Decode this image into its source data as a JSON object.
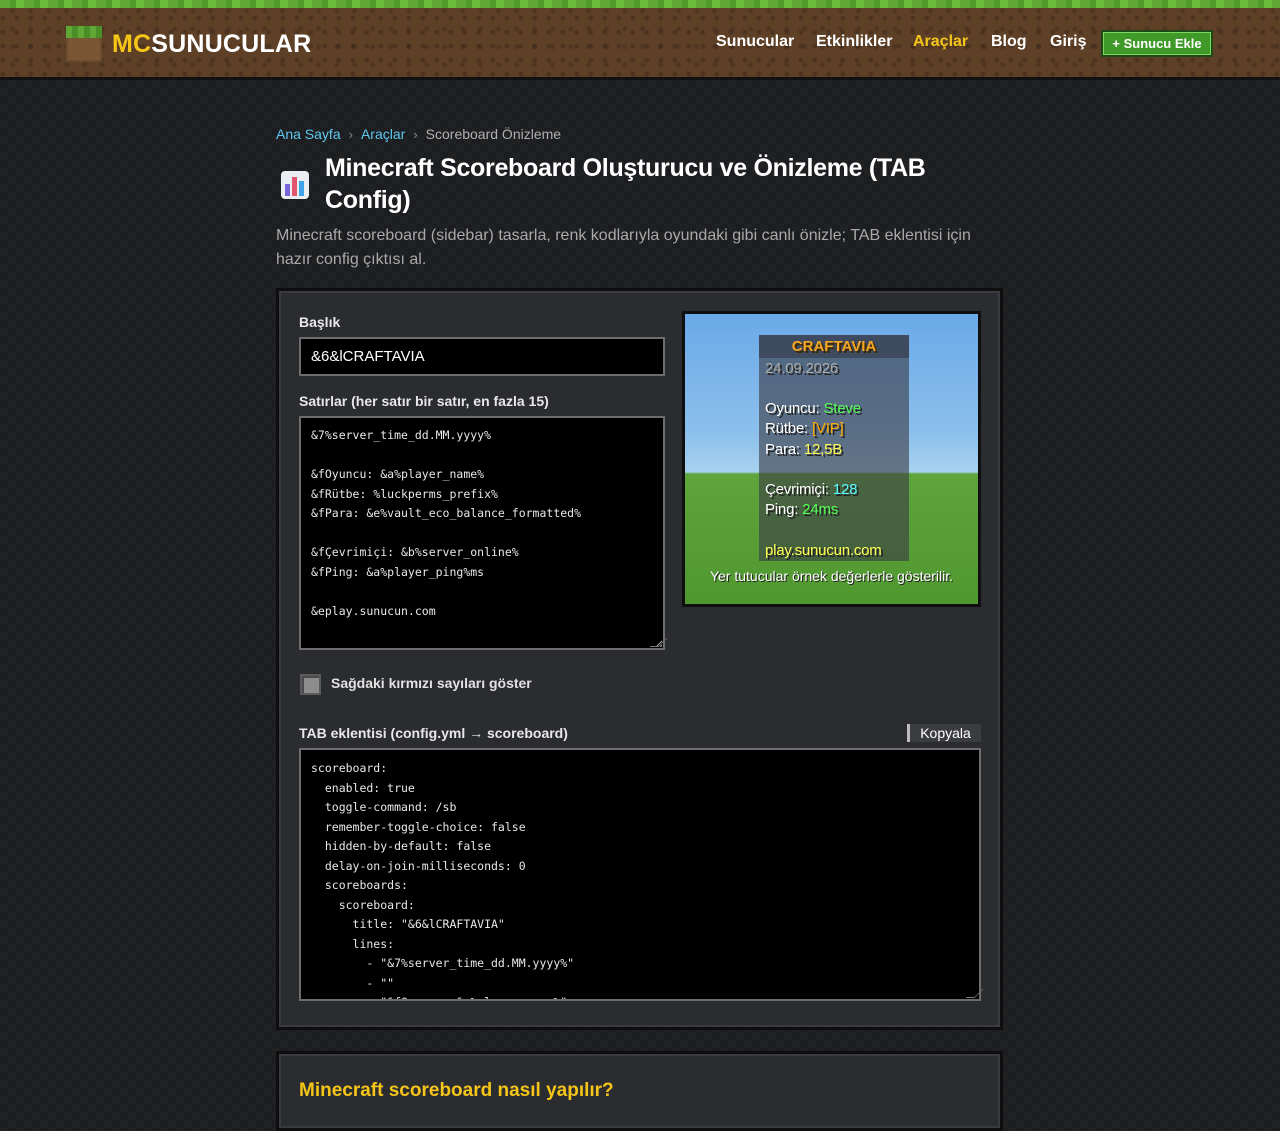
{
  "brand": {
    "prefix": "MC",
    "suffix": "SUNUCULAR"
  },
  "nav": [
    {
      "label": "Sunucular"
    },
    {
      "label": "Etkinlikler"
    },
    {
      "label": "Araçlar"
    },
    {
      "label": "Blog"
    },
    {
      "label": "Giriş"
    }
  ],
  "nav_active": "Araçlar",
  "add_server_label": "+ Sunucu Ekle",
  "breadcrumb": {
    "home": "Ana Sayfa",
    "tools": "Araçlar",
    "current": "Scoreboard Önizleme",
    "separator": "›"
  },
  "page": {
    "title": "Minecraft Scoreboard Oluşturucu ve Önizleme (TAB Config)",
    "description": "Minecraft scoreboard (sidebar) tasarla, renk kodlarıyla oyundaki gibi canlı önizle; TAB eklentisi için hazır config çıktısı al.",
    "icon": "bar-chart-icon"
  },
  "form": {
    "title_label": "Başlık",
    "title_value": "&6&lCRAFTAVIA",
    "lines_label": "Satırlar (her satır bir satır, en fazla 15)",
    "lines_value": "&7%server_time_dd.MM.yyyy%\n\n&fOyuncu: &a%player_name%\n&fRütbe: %luckperms_prefix%\n&fPara: &e%vault_eco_balance_formatted%\n\n&fÇevrimiçi: &b%server_online%\n&fPing: &a%player_ping%ms\n\n&eplay.sunucun.com",
    "checkbox_label": "Sağdaki kırmızı sayıları göster",
    "checkbox_checked": false,
    "config_label": "TAB eklentisi (config.yml → scoreboard)",
    "copy_label": "Kopyala",
    "config_value": "scoreboard:\n  enabled: true\n  toggle-command: /sb\n  remember-toggle-choice: false\n  hidden-by-default: false\n  delay-on-join-milliseconds: 0\n  scoreboards:\n    scoreboard:\n      title: \"&6&lCRAFTAVIA\"\n      lines:\n        - \"&7%server_time_dd.MM.yyyy%\"\n        - \"\"\n        - \"&fOyuncu: &a%player_name%\""
  },
  "preview": {
    "title": "CRAFTAVIA",
    "date": "24.09.2026",
    "player_label": "Oyuncu: ",
    "player_value": "Steve",
    "rank_label": "Rütbe: ",
    "rank_value": "[VIP]",
    "money_label": "Para: ",
    "money_value": "12,5B",
    "online_label": "Çevrimiçi: ",
    "online_value": "128",
    "ping_label": "Ping: ",
    "ping_value": "24ms",
    "address": "play.sunucun.com",
    "note": "Yer tutucular örnek değerlerle gösterilir."
  },
  "section2_heading": "Minecraft scoreboard nasıl yapılır?",
  "colors": {
    "accent": "#f5c518",
    "link": "#5ec8f0",
    "button_green": "#3f9a2a",
    "panel": "#2b2c30"
  }
}
